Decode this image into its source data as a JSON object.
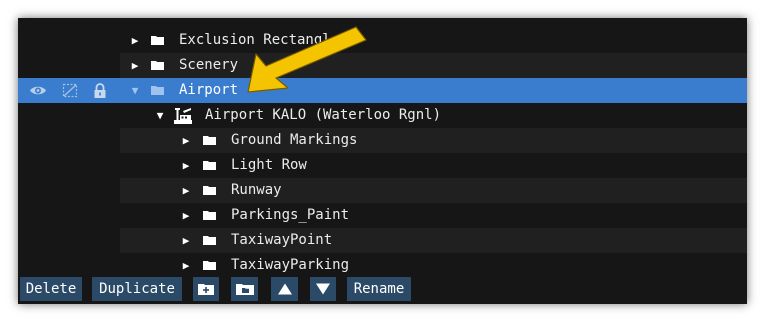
{
  "tree": {
    "rows": [
      {
        "label": "Exclusion Rectangle",
        "expanded": false,
        "level": 1
      },
      {
        "label": "Scenery",
        "expanded": false,
        "level": 1
      },
      {
        "label": "Airport",
        "expanded": true,
        "level": 1,
        "selected": true
      },
      {
        "label": "Airport KALO (Waterloo Rgnl)",
        "expanded": true,
        "level": 2,
        "icon": "airport-icon"
      },
      {
        "label": "Ground Markings",
        "expanded": false,
        "level": 3
      },
      {
        "label": "Light Row",
        "expanded": false,
        "level": 3
      },
      {
        "label": "Runway",
        "expanded": false,
        "level": 3
      },
      {
        "label": "Parkings_Paint",
        "expanded": false,
        "level": 3
      },
      {
        "label": "TaxiwayPoint",
        "expanded": false,
        "level": 3
      },
      {
        "label": "TaxiwayParking",
        "expanded": false,
        "level": 3
      }
    ],
    "selected_row_icons": [
      "eye-icon",
      "hide-bbox-icon",
      "lock-icon"
    ]
  },
  "toolbar": {
    "delete_label": "Delete",
    "duplicate_label": "Duplicate",
    "icon_buttons": [
      "new-item-icon",
      "new-folder-icon",
      "move-up-icon",
      "move-down-icon"
    ],
    "rename_label": "Rename"
  },
  "colors": {
    "panel_bg": "#161616",
    "row_alt_bg": "#202020",
    "selection": "#3a7ccd",
    "button_bg": "#2b4a68",
    "arrow": "#f5c400"
  }
}
